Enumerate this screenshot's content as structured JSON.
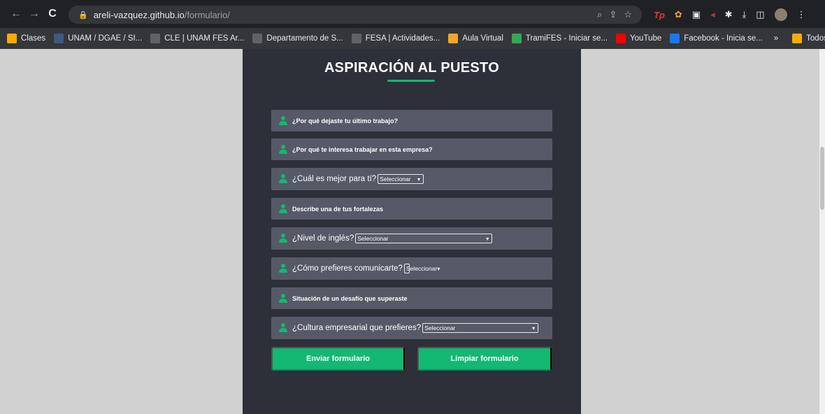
{
  "browser": {
    "url_host": "areli-vazquez.github.io",
    "url_path": "/formulario/",
    "extensions": [
      "Tp"
    ]
  },
  "bookmarks": [
    {
      "label": "Clases",
      "color": "#f9ab00"
    },
    {
      "label": "UNAM / DGAE / SI...",
      "color": "#3d5a80"
    },
    {
      "label": "CLE | UNAM FES Ar...",
      "color": "#5f6368"
    },
    {
      "label": "Departamento de S...",
      "color": "#5f6368"
    },
    {
      "label": "FESA | Actividades...",
      "color": "#5f6368"
    },
    {
      "label": "Aula Virtual",
      "color": "#f4a52b"
    },
    {
      "label": "TramiFES - Iniciar se...",
      "color": "#34a853"
    },
    {
      "label": "YouTube",
      "color": "#ff0000"
    },
    {
      "label": "Facebook - Inicia se...",
      "color": "#1877f2"
    }
  ],
  "bookmarks_overflow": "»",
  "all_bookmarks": "Todos los marcadores",
  "form": {
    "title": "ASPIRACIÓN AL PUESTO",
    "fields": [
      {
        "label": "¿Por qué dejaste tu último trabajo?",
        "style": "small"
      },
      {
        "label": "¿Por qué te interesa trabajar en esta empresa?",
        "style": "small"
      },
      {
        "label": "¿Cuál es mejor para tí?",
        "style": "big",
        "select": "Seleccionar"
      },
      {
        "label": "Describe una de tus fortalezas",
        "style": "small"
      },
      {
        "label": "¿Nivel de inglés?",
        "style": "big",
        "select": "Seleccionar"
      },
      {
        "label": "¿Cómo prefieres comunicarte?",
        "style": "big",
        "select": "Seleccionar"
      },
      {
        "label": "Situación de un desafío que superaste",
        "style": "small"
      },
      {
        "label": "¿Cultura empresarial que prefieres?",
        "style": "big",
        "select": "Seleccionar"
      }
    ],
    "submit_label": "Enviar formulario",
    "clear_label": "Limpiar formulario"
  },
  "colors": {
    "accent": "#13b872",
    "panel": "#2d3038",
    "field": "#555a66"
  }
}
